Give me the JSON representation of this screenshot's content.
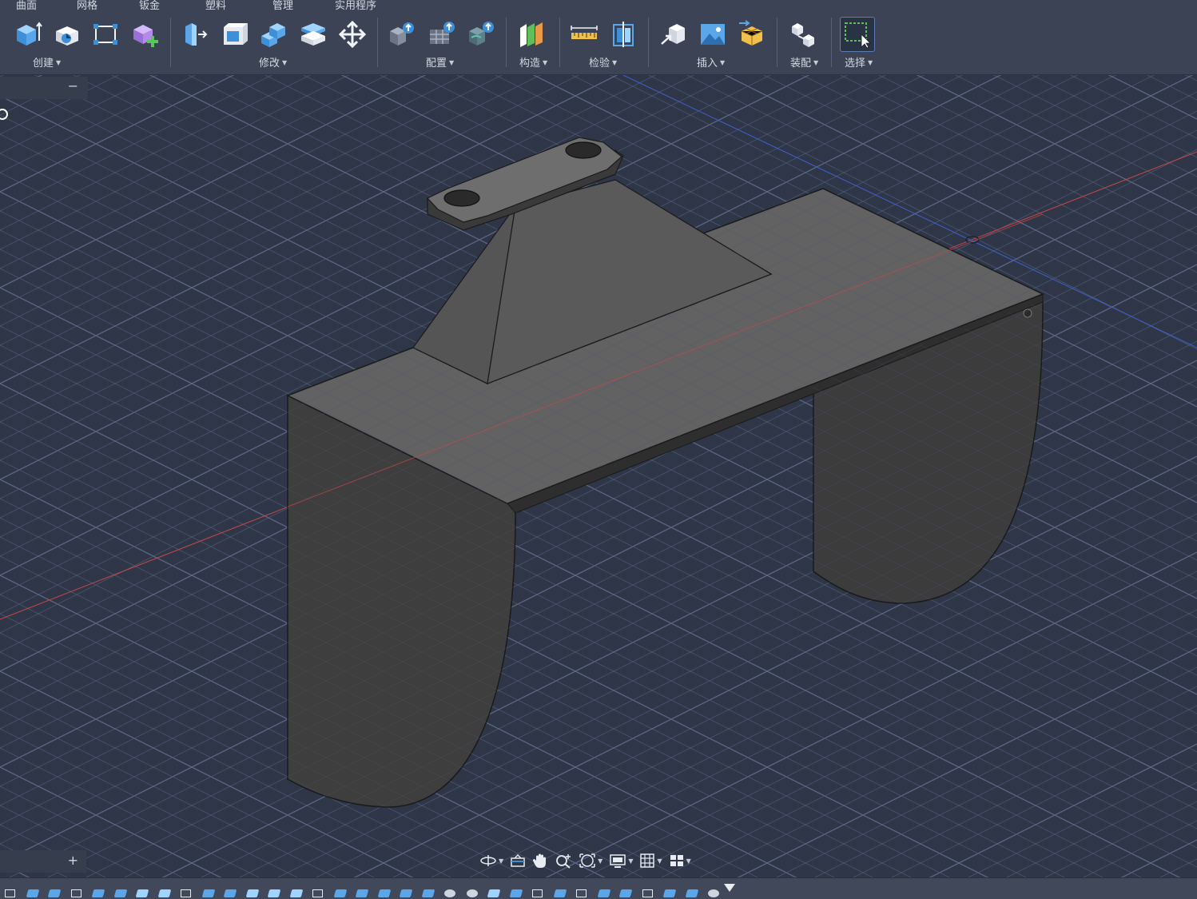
{
  "tabs": [
    "曲面",
    "网格",
    "钣金",
    "塑料",
    "管理",
    "实用程序"
  ],
  "groups": {
    "create": "创建",
    "modify": "修改",
    "configure": "配置",
    "construct": "构造",
    "inspect": "检验",
    "insert": "插入",
    "assemble": "装配",
    "select": "选择"
  },
  "tools": {
    "create": [
      "extrude-icon",
      "revolve-icon",
      "sketch-rectangle-icon",
      "new-component-icon"
    ],
    "modify": [
      "press-pull-icon",
      "shell-icon",
      "combine-icon",
      "split-face-icon",
      "move-icon"
    ],
    "configure": [
      "configure-upload-icon",
      "table-upload-icon",
      "parameter-upload-icon"
    ],
    "construct": [
      "offset-plane-icon"
    ],
    "inspect": [
      "measure-icon",
      "section-analysis-icon"
    ],
    "insert": [
      "insert-derive-icon",
      "insert-image-icon",
      "insert-mesh-icon"
    ],
    "assemble": [
      "joint-icon"
    ],
    "select": [
      "window-select-icon"
    ]
  },
  "browser": {
    "collapse_symbol": "−"
  },
  "comments": {
    "add_symbol": "+"
  },
  "navbar": [
    "orbit-icon",
    "look-at-icon",
    "pan-icon",
    "zoom-icon",
    "fit-icon",
    "display-settings-icon",
    "grid-settings-icon",
    "viewports-icon"
  ],
  "colors": {
    "toolbar_bg": "#3c4354",
    "viewport_bg": "#2e3647",
    "grid_line": "#4a5470",
    "x_axis": "#c84848",
    "y_axis": "#4060d0",
    "model_top": "#626262",
    "model_side": "#3e3e3e",
    "accent_blue": "#3d8fd8"
  }
}
